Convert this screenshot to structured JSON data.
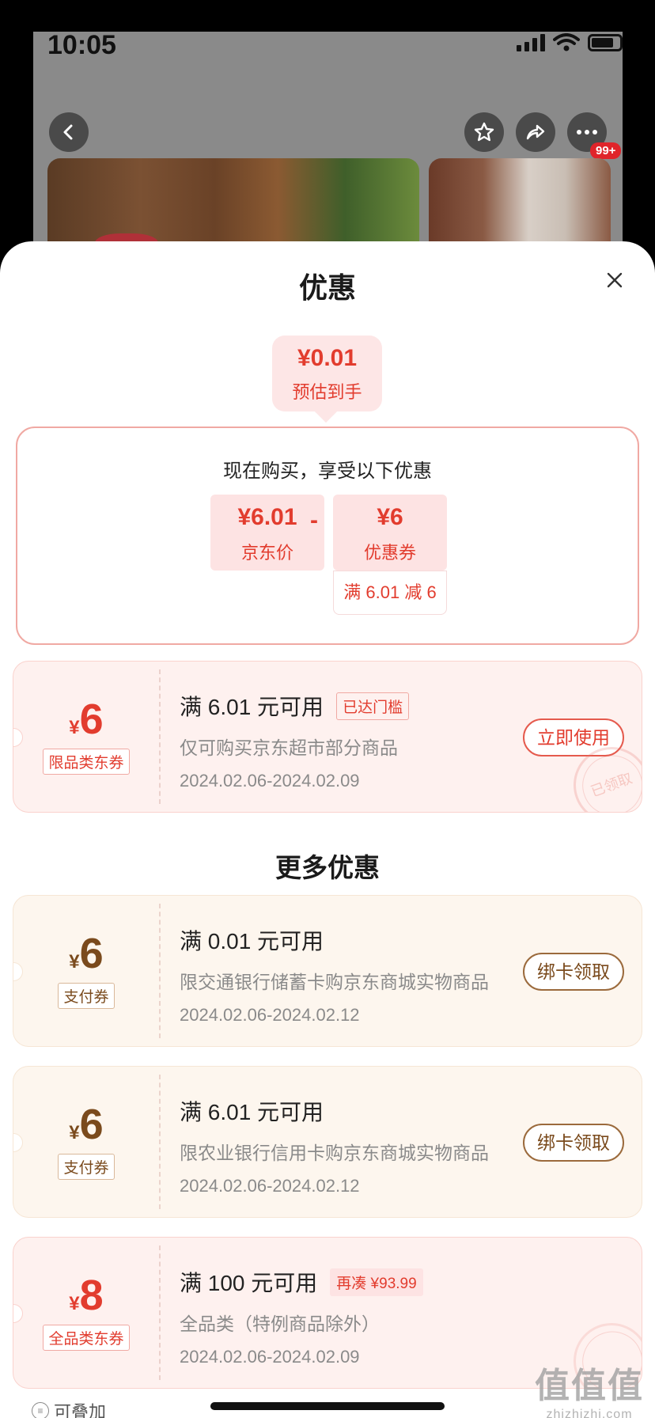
{
  "status_bar": {
    "time": "10:05"
  },
  "product_bg": {
    "cart_badge": "99+"
  },
  "sheet": {
    "title": "优惠",
    "estimate": {
      "price": "¥0.01",
      "label": "预估到手"
    },
    "calc": {
      "heading": "现在购买，享受以下优惠",
      "price": {
        "value": "¥6.01",
        "label": "京东价"
      },
      "operator": "-",
      "coupon": {
        "value": "¥6",
        "label": "优惠券"
      },
      "condition": "满 6.01 减 6"
    },
    "main_coupon": {
      "currency": "¥",
      "amount": "6",
      "type": "限品类东券",
      "condition": "满 6.01 元可用",
      "status_chip": "已达门槛",
      "description": "仅可购买京东超市部分商品",
      "date": "2024.02.06-2024.02.09",
      "action": "立即使用",
      "stamp": "已领取"
    },
    "more_title": "更多优惠",
    "more_coupons": [
      {
        "currency": "¥",
        "amount": "6",
        "type": "支付券",
        "condition": "满 0.01 元可用",
        "description": "限交通银行储蓄卡购京东商城实物商品",
        "date": "2024.02.06-2024.02.12",
        "action": "绑卡领取"
      },
      {
        "currency": "¥",
        "amount": "6",
        "type": "支付券",
        "condition": "满 6.01 元可用",
        "description": "限农业银行信用卡购京东商城实物商品",
        "date": "2024.02.06-2024.02.12",
        "action": "绑卡领取"
      },
      {
        "currency": "¥",
        "amount": "8",
        "type": "全品类东券",
        "condition": "满 100 元可用",
        "chip": "再凑 ¥93.99",
        "description": "全品类（特例商品除外）",
        "date": "2024.02.06-2024.02.09"
      }
    ],
    "stackable": "可叠加",
    "watermark": {
      "logo": "值值值",
      "site": "zhizhizhi.com"
    }
  }
}
